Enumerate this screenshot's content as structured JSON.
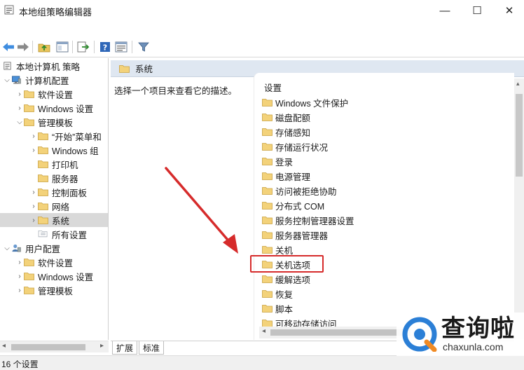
{
  "window": {
    "title": "本地组策略编辑器",
    "minimize_glyph": "—",
    "maximize_glyph": "☐",
    "close_glyph": "✕"
  },
  "toolbar": {
    "buttons": [
      "back-icon",
      "forward-icon",
      "up-folder-icon",
      "show-hide-tree-icon",
      "export-list-icon",
      "help-icon",
      "properties-view-icon",
      "filter-icon"
    ]
  },
  "tree": {
    "items": [
      {
        "label": "本地计算机 策略",
        "expander": ""
      },
      {
        "label": "计算机配置",
        "expander": "⌵"
      },
      {
        "label": "软件设置",
        "expander": "›"
      },
      {
        "label": "Windows 设置",
        "expander": "›"
      },
      {
        "label": "管理模板",
        "expander": "⌵"
      },
      {
        "label": "“开始”菜单和",
        "expander": "›"
      },
      {
        "label": "Windows 组",
        "expander": "›"
      },
      {
        "label": "打印机",
        "expander": ""
      },
      {
        "label": "服务器",
        "expander": ""
      },
      {
        "label": "控制面板",
        "expander": "›"
      },
      {
        "label": "网络",
        "expander": "›"
      },
      {
        "label": "系统",
        "expander": "›"
      },
      {
        "label": "所有设置",
        "expander": ""
      },
      {
        "label": "用户配置",
        "expander": "⌵"
      },
      {
        "label": "软件设置",
        "expander": "›"
      },
      {
        "label": "Windows 设置",
        "expander": "›"
      },
      {
        "label": "管理模板",
        "expander": "›"
      }
    ]
  },
  "right_pane": {
    "header": "系统",
    "description": "选择一个项目来查看它的描述。",
    "column_header": "设置",
    "items": [
      "Windows 文件保护",
      "磁盘配额",
      "存储感知",
      "存储运行状况",
      "登录",
      "电源管理",
      "访问被拒绝协助",
      "分布式 COM",
      "服务控制管理器设置",
      "服务器管理器",
      "关机",
      "关机选项",
      "缓解选项",
      "恢复",
      "脚本",
      "可移动存储访问"
    ]
  },
  "tabs": [
    "扩展",
    "标准"
  ],
  "status": "16 个设置",
  "annotation": {
    "highlight_color": "#d62b2b"
  },
  "watermark": {
    "cn": "查询啦",
    "en": "chaxunla.com",
    "accent": "#2b7fd6"
  }
}
